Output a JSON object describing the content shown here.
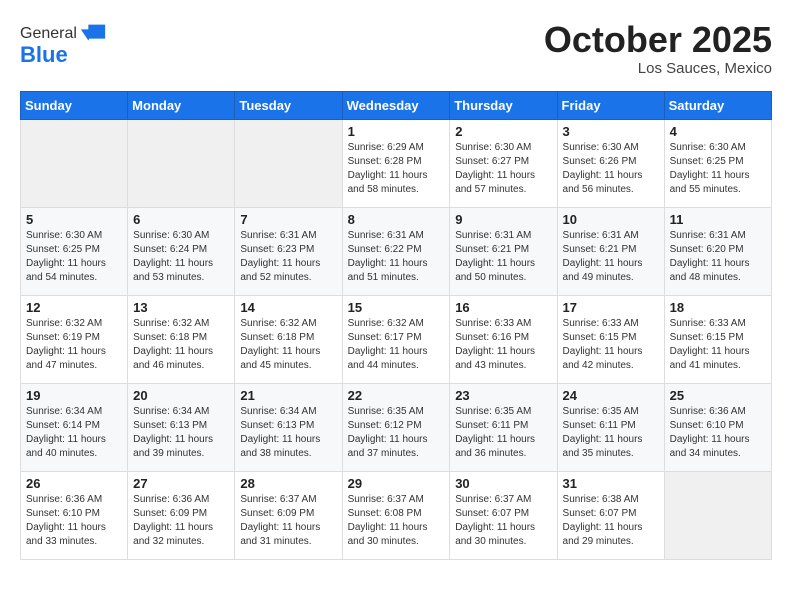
{
  "logo": {
    "general": "General",
    "blue": "Blue"
  },
  "header": {
    "month": "October 2025",
    "location": "Los Sauces, Mexico"
  },
  "weekdays": [
    "Sunday",
    "Monday",
    "Tuesday",
    "Wednesday",
    "Thursday",
    "Friday",
    "Saturday"
  ],
  "weeks": [
    [
      {
        "day": "",
        "sunrise": "",
        "sunset": "",
        "daylight": ""
      },
      {
        "day": "",
        "sunrise": "",
        "sunset": "",
        "daylight": ""
      },
      {
        "day": "",
        "sunrise": "",
        "sunset": "",
        "daylight": ""
      },
      {
        "day": "1",
        "sunrise": "Sunrise: 6:29 AM",
        "sunset": "Sunset: 6:28 PM",
        "daylight": "Daylight: 11 hours and 58 minutes."
      },
      {
        "day": "2",
        "sunrise": "Sunrise: 6:30 AM",
        "sunset": "Sunset: 6:27 PM",
        "daylight": "Daylight: 11 hours and 57 minutes."
      },
      {
        "day": "3",
        "sunrise": "Sunrise: 6:30 AM",
        "sunset": "Sunset: 6:26 PM",
        "daylight": "Daylight: 11 hours and 56 minutes."
      },
      {
        "day": "4",
        "sunrise": "Sunrise: 6:30 AM",
        "sunset": "Sunset: 6:25 PM",
        "daylight": "Daylight: 11 hours and 55 minutes."
      }
    ],
    [
      {
        "day": "5",
        "sunrise": "Sunrise: 6:30 AM",
        "sunset": "Sunset: 6:25 PM",
        "daylight": "Daylight: 11 hours and 54 minutes."
      },
      {
        "day": "6",
        "sunrise": "Sunrise: 6:30 AM",
        "sunset": "Sunset: 6:24 PM",
        "daylight": "Daylight: 11 hours and 53 minutes."
      },
      {
        "day": "7",
        "sunrise": "Sunrise: 6:31 AM",
        "sunset": "Sunset: 6:23 PM",
        "daylight": "Daylight: 11 hours and 52 minutes."
      },
      {
        "day": "8",
        "sunrise": "Sunrise: 6:31 AM",
        "sunset": "Sunset: 6:22 PM",
        "daylight": "Daylight: 11 hours and 51 minutes."
      },
      {
        "day": "9",
        "sunrise": "Sunrise: 6:31 AM",
        "sunset": "Sunset: 6:21 PM",
        "daylight": "Daylight: 11 hours and 50 minutes."
      },
      {
        "day": "10",
        "sunrise": "Sunrise: 6:31 AM",
        "sunset": "Sunset: 6:21 PM",
        "daylight": "Daylight: 11 hours and 49 minutes."
      },
      {
        "day": "11",
        "sunrise": "Sunrise: 6:31 AM",
        "sunset": "Sunset: 6:20 PM",
        "daylight": "Daylight: 11 hours and 48 minutes."
      }
    ],
    [
      {
        "day": "12",
        "sunrise": "Sunrise: 6:32 AM",
        "sunset": "Sunset: 6:19 PM",
        "daylight": "Daylight: 11 hours and 47 minutes."
      },
      {
        "day": "13",
        "sunrise": "Sunrise: 6:32 AM",
        "sunset": "Sunset: 6:18 PM",
        "daylight": "Daylight: 11 hours and 46 minutes."
      },
      {
        "day": "14",
        "sunrise": "Sunrise: 6:32 AM",
        "sunset": "Sunset: 6:18 PM",
        "daylight": "Daylight: 11 hours and 45 minutes."
      },
      {
        "day": "15",
        "sunrise": "Sunrise: 6:32 AM",
        "sunset": "Sunset: 6:17 PM",
        "daylight": "Daylight: 11 hours and 44 minutes."
      },
      {
        "day": "16",
        "sunrise": "Sunrise: 6:33 AM",
        "sunset": "Sunset: 6:16 PM",
        "daylight": "Daylight: 11 hours and 43 minutes."
      },
      {
        "day": "17",
        "sunrise": "Sunrise: 6:33 AM",
        "sunset": "Sunset: 6:15 PM",
        "daylight": "Daylight: 11 hours and 42 minutes."
      },
      {
        "day": "18",
        "sunrise": "Sunrise: 6:33 AM",
        "sunset": "Sunset: 6:15 PM",
        "daylight": "Daylight: 11 hours and 41 minutes."
      }
    ],
    [
      {
        "day": "19",
        "sunrise": "Sunrise: 6:34 AM",
        "sunset": "Sunset: 6:14 PM",
        "daylight": "Daylight: 11 hours and 40 minutes."
      },
      {
        "day": "20",
        "sunrise": "Sunrise: 6:34 AM",
        "sunset": "Sunset: 6:13 PM",
        "daylight": "Daylight: 11 hours and 39 minutes."
      },
      {
        "day": "21",
        "sunrise": "Sunrise: 6:34 AM",
        "sunset": "Sunset: 6:13 PM",
        "daylight": "Daylight: 11 hours and 38 minutes."
      },
      {
        "day": "22",
        "sunrise": "Sunrise: 6:35 AM",
        "sunset": "Sunset: 6:12 PM",
        "daylight": "Daylight: 11 hours and 37 minutes."
      },
      {
        "day": "23",
        "sunrise": "Sunrise: 6:35 AM",
        "sunset": "Sunset: 6:11 PM",
        "daylight": "Daylight: 11 hours and 36 minutes."
      },
      {
        "day": "24",
        "sunrise": "Sunrise: 6:35 AM",
        "sunset": "Sunset: 6:11 PM",
        "daylight": "Daylight: 11 hours and 35 minutes."
      },
      {
        "day": "25",
        "sunrise": "Sunrise: 6:36 AM",
        "sunset": "Sunset: 6:10 PM",
        "daylight": "Daylight: 11 hours and 34 minutes."
      }
    ],
    [
      {
        "day": "26",
        "sunrise": "Sunrise: 6:36 AM",
        "sunset": "Sunset: 6:10 PM",
        "daylight": "Daylight: 11 hours and 33 minutes."
      },
      {
        "day": "27",
        "sunrise": "Sunrise: 6:36 AM",
        "sunset": "Sunset: 6:09 PM",
        "daylight": "Daylight: 11 hours and 32 minutes."
      },
      {
        "day": "28",
        "sunrise": "Sunrise: 6:37 AM",
        "sunset": "Sunset: 6:09 PM",
        "daylight": "Daylight: 11 hours and 31 minutes."
      },
      {
        "day": "29",
        "sunrise": "Sunrise: 6:37 AM",
        "sunset": "Sunset: 6:08 PM",
        "daylight": "Daylight: 11 hours and 30 minutes."
      },
      {
        "day": "30",
        "sunrise": "Sunrise: 6:37 AM",
        "sunset": "Sunset: 6:07 PM",
        "daylight": "Daylight: 11 hours and 30 minutes."
      },
      {
        "day": "31",
        "sunrise": "Sunrise: 6:38 AM",
        "sunset": "Sunset: 6:07 PM",
        "daylight": "Daylight: 11 hours and 29 minutes."
      },
      {
        "day": "",
        "sunrise": "",
        "sunset": "",
        "daylight": ""
      }
    ]
  ]
}
